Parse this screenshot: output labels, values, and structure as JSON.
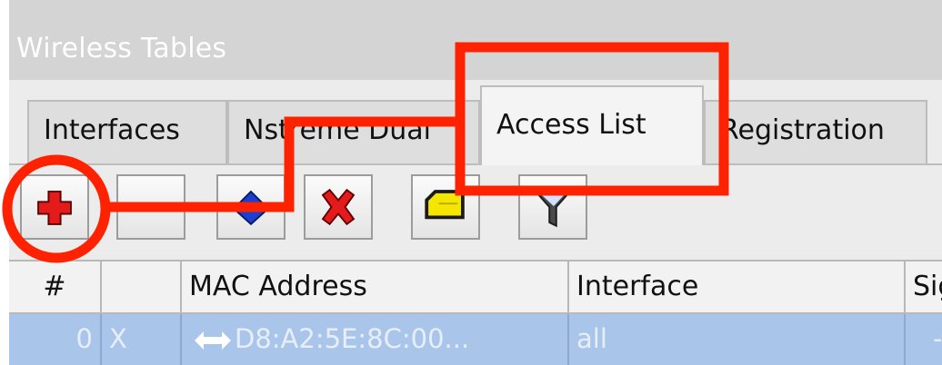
{
  "window": {
    "title": "Wireless Tables"
  },
  "tabs": [
    {
      "label": "Interfaces",
      "active": false
    },
    {
      "label": "Nstreme Dual",
      "active": false
    },
    {
      "label": "Access List",
      "active": true
    },
    {
      "label": "Registration",
      "active": false
    }
  ],
  "toolbar": {
    "buttons": [
      {
        "name": "add-icon"
      },
      {
        "name": "remove-icon"
      },
      {
        "name": "enable-icon"
      },
      {
        "name": "disable-icon"
      },
      {
        "name": "comment-icon"
      },
      {
        "name": "filter-icon"
      }
    ]
  },
  "table": {
    "columns": [
      "#",
      "",
      "MAC Address",
      "Interface",
      "Sig"
    ],
    "rows": [
      {
        "index": "0",
        "flag": "X",
        "mac": "D8:A2:5E:8C:00...",
        "interface": "all",
        "signal": "-"
      }
    ]
  },
  "colors": {
    "annotation": "#ff2200",
    "selected_row": "#a9c6ea",
    "add_icon": "#e51a1a",
    "disable_icon": "#e51a1a",
    "enable_icon": "#1a3fd1",
    "comment_icon": "#f5e600"
  }
}
